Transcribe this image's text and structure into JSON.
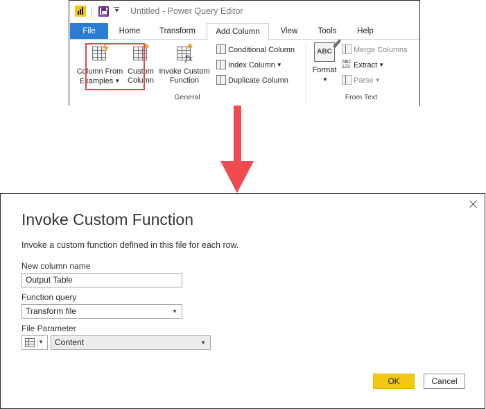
{
  "window": {
    "title": "Untitled - Power Query Editor"
  },
  "tabs": [
    {
      "label": "File"
    },
    {
      "label": "Home"
    },
    {
      "label": "Transform"
    },
    {
      "label": "Add Column"
    },
    {
      "label": "View"
    },
    {
      "label": "Tools"
    },
    {
      "label": "Help"
    }
  ],
  "ribbon": {
    "general": {
      "label": "General",
      "column_from_examples": {
        "line1": "Column From",
        "line2": "Examples"
      },
      "custom_column": {
        "line1": "Custom",
        "line2": "Column"
      },
      "invoke_custom_function": {
        "line1": "Invoke Custom",
        "line2": "Function"
      },
      "conditional_column": "Conditional Column",
      "index_column": "Index Column",
      "duplicate_column": "Duplicate Column"
    },
    "from_text": {
      "label": "From Text",
      "format": "Format",
      "merge_columns": "Merge Columns",
      "extract": "Extract",
      "parse": "Parse",
      "abc_icon": "ABC",
      "abc123_top": "ABC",
      "abc123_bottom": "123"
    }
  },
  "dialog": {
    "title": "Invoke Custom Function",
    "description": "Invoke a custom function defined in this file for each row.",
    "new_column_name": {
      "label": "New column name",
      "value": "Output Table"
    },
    "function_query": {
      "label": "Function query",
      "value": "Transform file"
    },
    "file_parameter": {
      "label": "File Parameter",
      "value": "Content"
    },
    "ok_label": "OK",
    "cancel_label": "Cancel"
  },
  "colors": {
    "file_tab": "#2b7cd3",
    "highlight": "#e0464c",
    "arrow": "#ef4a50",
    "ok_button": "#f2c811"
  }
}
